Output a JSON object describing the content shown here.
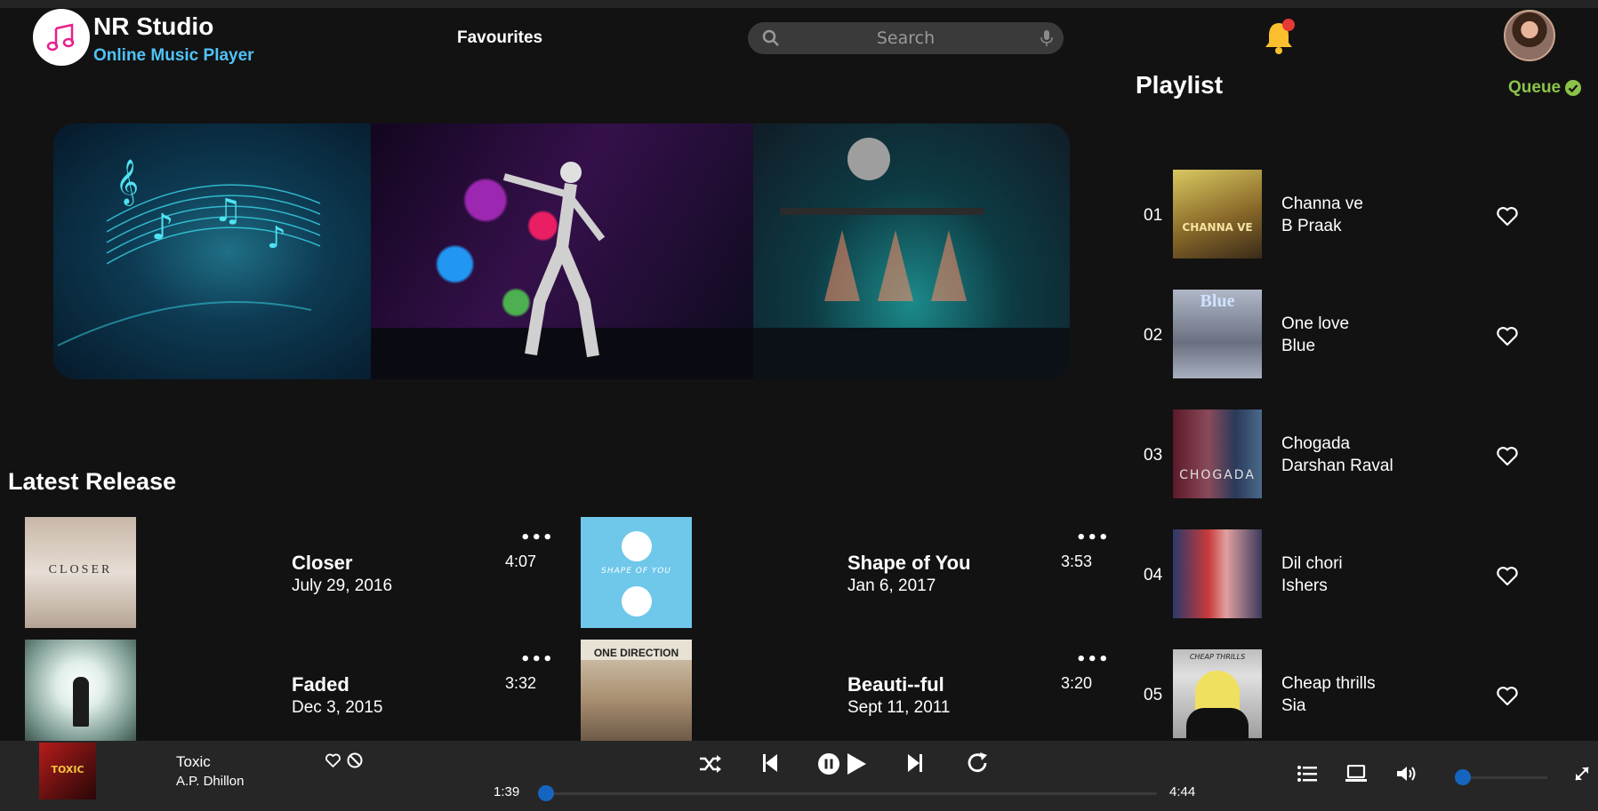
{
  "header": {
    "brand_title": "NR Studio",
    "brand_subtitle": "Online Music Player",
    "nav_favourites": "Favourites",
    "search_placeholder": "Search"
  },
  "latest_release": {
    "title": "Latest Release",
    "items": [
      {
        "name": "Closer",
        "date": "July 29, 2016",
        "duration": "4:07",
        "more": "•••"
      },
      {
        "name": "Shape of You",
        "date": "Jan 6, 2017",
        "duration": "3:53",
        "more": "•••"
      },
      {
        "name": "Faded",
        "date": "Dec 3, 2015",
        "duration": "3:32",
        "more": "•••"
      },
      {
        "name": "Beauti--ful",
        "date": "Sept 11, 2011",
        "duration": "3:20",
        "more": "•••"
      }
    ],
    "cover_texts": {
      "closer": "CLOSER",
      "shape": "SHAPE OF YOU",
      "onedirection": "ONE DIRECTION"
    }
  },
  "playlist": {
    "title": "Playlist",
    "queue_label": "Queue",
    "items": [
      {
        "num": "01",
        "title": "Channa ve",
        "artist": "B Praak",
        "cover_text": "CHANNA VE"
      },
      {
        "num": "02",
        "title": "One love",
        "artist": "Blue",
        "cover_text": "Blue"
      },
      {
        "num": "03",
        "title": "Chogada",
        "artist": "Darshan Raval",
        "cover_text": "CHOGADA"
      },
      {
        "num": "04",
        "title": "Dil chori",
        "artist": "Ishers",
        "cover_text": ""
      },
      {
        "num": "05",
        "title": "Cheap thrills",
        "artist": "Sia",
        "cover_text": "CHEAP THRILLS"
      }
    ]
  },
  "player": {
    "title": "Toxic",
    "artist": "A.P. Dhillon",
    "current_time": "1:39",
    "total_time": "4:44",
    "progress": 0.0,
    "volume": 0.05,
    "cover_text": "TOXIC"
  },
  "colors": {
    "background": "#121212",
    "player_bar": "#262626",
    "accent_blue": "#4fc3f7",
    "queue_green": "#8bc34a",
    "bell_yellow": "#fbc02d",
    "notification_red": "#e53935",
    "slider_blue": "#1565c0"
  }
}
